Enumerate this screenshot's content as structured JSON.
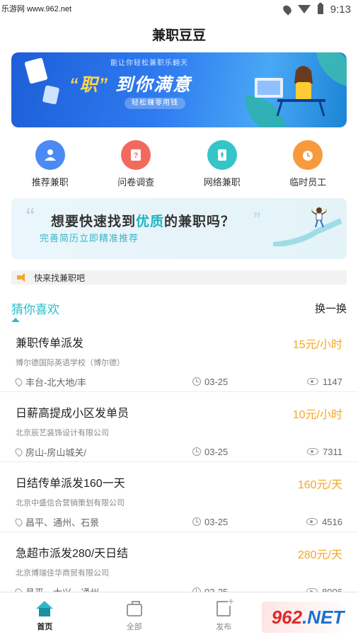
{
  "status_bar": {
    "watermark": "乐游网 www.962.net",
    "time": "9:13"
  },
  "header": {
    "title": "兼职豆豆"
  },
  "banner": {
    "subtitle": "能让你轻松兼职乐翻天",
    "headline_quote": "“职”",
    "headline_rest": "到你满意",
    "pill": "轻松赚零用钱"
  },
  "quick_nav": [
    {
      "label": "推荐兼职",
      "icon": "user-recommend-icon",
      "color": "#4a8af4"
    },
    {
      "label": "问卷调查",
      "icon": "questionnaire-icon",
      "color": "#f26a5e"
    },
    {
      "label": "网络兼职",
      "icon": "network-job-icon",
      "color": "#34c5c9"
    },
    {
      "label": "临时员工",
      "icon": "clock-icon",
      "color": "#f79a3e"
    }
  ],
  "promo": {
    "line1_pre": "想要快速找到",
    "line1_em": "优质",
    "line1_post": "的兼职吗？",
    "line2": "完善简历立即精准推荐"
  },
  "notice": {
    "text": "快来找兼职吧"
  },
  "section": {
    "title": "猜你喜欢",
    "refresh": "换一换"
  },
  "jobs": [
    {
      "title": "兼职传单派发",
      "pay": "15元/小时",
      "company": "博尔德国际英语学校（博尔德）",
      "location": "丰台-北大地/丰",
      "date": "03-25",
      "views": "1147"
    },
    {
      "title": "日薪高提成小区发单员",
      "pay": "10元/小时",
      "company": "北京辰艺装饰设计有限公司",
      "location": "房山-房山城关/",
      "date": "03-25",
      "views": "7311"
    },
    {
      "title": "日结传单派发160一天",
      "pay": "160元/天",
      "company": "北京中盛信合营销策划有限公司",
      "location": "昌平、通州、石景",
      "date": "03-25",
      "views": "4516"
    },
    {
      "title": "急超市派发280/天日结",
      "pay": "280元/天",
      "company": "北京博瑞佳华商贸有限公司",
      "location": "昌平、大兴、通州",
      "date": "03-25",
      "views": "8006"
    }
  ],
  "tabbar": [
    {
      "label": "首页",
      "active": true
    },
    {
      "label": "全部",
      "active": false
    },
    {
      "label": "发布",
      "active": false
    }
  ],
  "watermark_corner": {
    "text_a": "962",
    "text_b": ".NET"
  },
  "colors": {
    "accent": "#2abbc8",
    "pay": "#f5a623",
    "banner": "#2f7bf0"
  }
}
